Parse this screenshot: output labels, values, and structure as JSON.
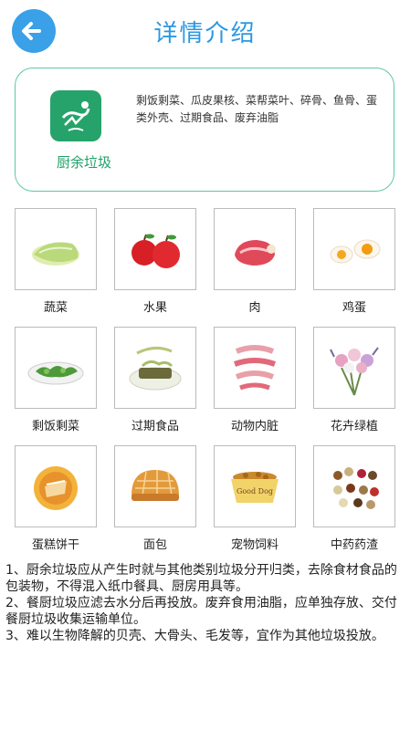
{
  "header": {
    "title": "详情介绍"
  },
  "category": {
    "name": "厨余垃圾",
    "description": "剩饭剩菜、瓜皮果核、菜帮菜叶、碎骨、鱼骨、蛋类外壳、过期食品、废弃油脂"
  },
  "items": [
    {
      "label": "蔬菜",
      "icon": "cabbage-icon"
    },
    {
      "label": "水果",
      "icon": "apple-icon"
    },
    {
      "label": "肉",
      "icon": "meat-icon"
    },
    {
      "label": "鸡蛋",
      "icon": "egg-icon"
    },
    {
      "label": "剩饭剩菜",
      "icon": "leftovers-icon"
    },
    {
      "label": "过期食品",
      "icon": "expired-food-icon"
    },
    {
      "label": "动物内脏",
      "icon": "offal-icon"
    },
    {
      "label": "花卉绿植",
      "icon": "flowers-icon"
    },
    {
      "label": "蛋糕饼干",
      "icon": "cake-icon"
    },
    {
      "label": "面包",
      "icon": "bread-icon"
    },
    {
      "label": "宠物饲料",
      "icon": "pet-food-icon"
    },
    {
      "label": "中药药渣",
      "icon": "herbs-icon"
    }
  ],
  "pet_food_text": "Good Dog",
  "notes": [
    "1、厨余垃圾应从产生时就与其他类别垃圾分开归类，去除食材食品的包装物，不得混入纸巾餐具、厨房用具等。",
    "2、餐厨垃圾应滤去水分后再投放。废弃食用油脂，应单独存放、交付餐厨垃圾收集运输单位。",
    "3、难以生物降解的贝壳、大骨头、毛发等，宜作为其他垃圾投放。"
  ],
  "colors": {
    "accent": "#2b97e0",
    "green": "#26a36a",
    "border": "#5cc8a8"
  }
}
